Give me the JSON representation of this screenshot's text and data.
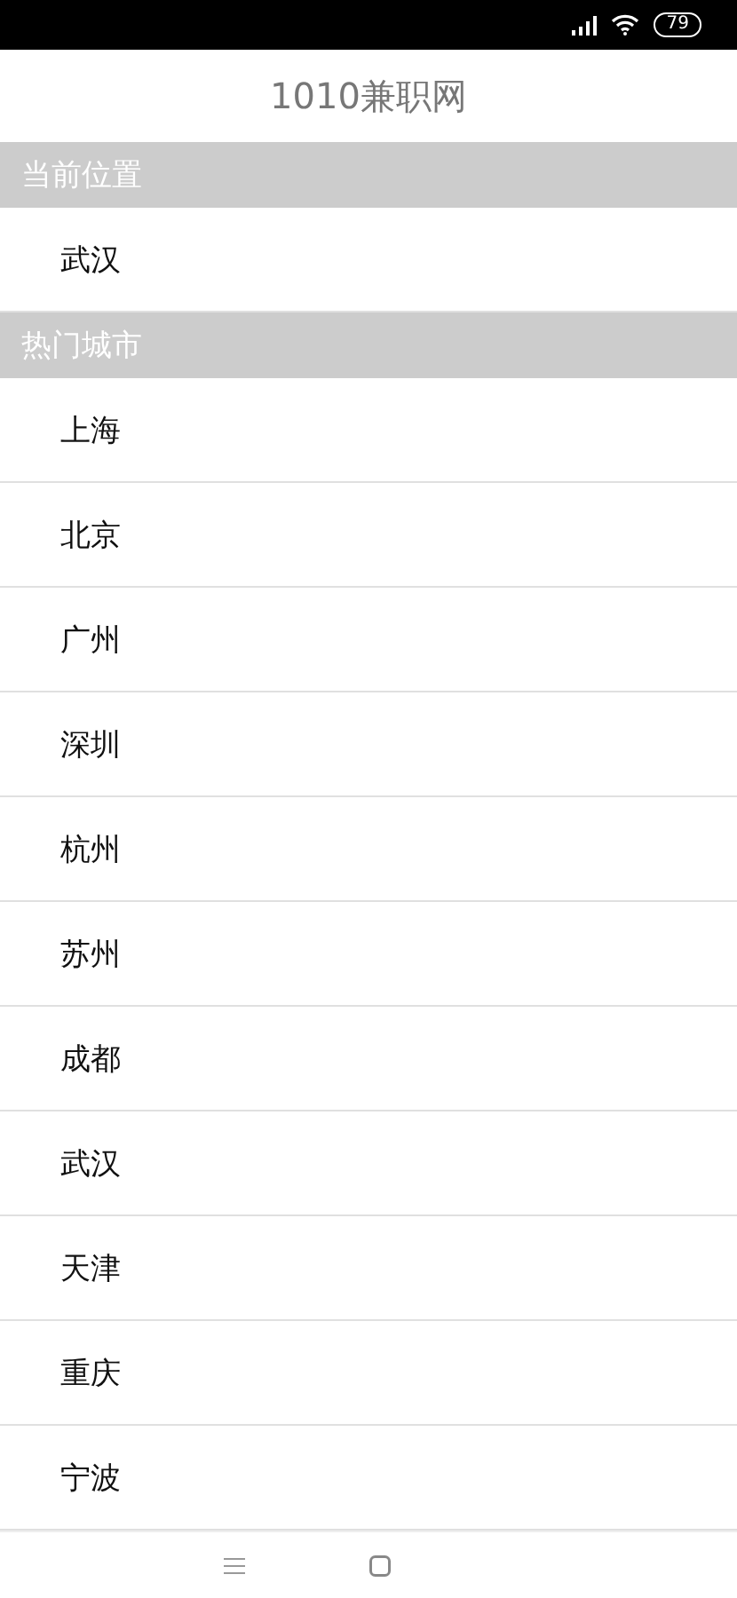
{
  "status_bar": {
    "battery": "79"
  },
  "title": "1010兼职网",
  "sections": [
    {
      "header": "当前位置",
      "cities": [
        "武汉"
      ]
    },
    {
      "header": "热门城市",
      "cities": [
        "上海",
        "北京",
        "广州",
        "深圳",
        "杭州",
        "苏州",
        "成都",
        "武汉",
        "天津",
        "重庆",
        "宁波"
      ]
    }
  ]
}
